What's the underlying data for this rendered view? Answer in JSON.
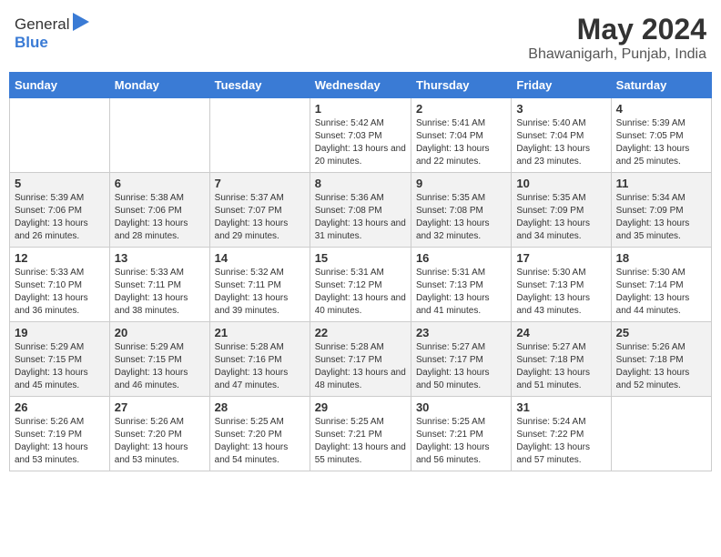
{
  "header": {
    "logo_general": "General",
    "logo_blue": "Blue",
    "title": "May 2024",
    "subtitle": "Bhawanigarh, Punjab, India"
  },
  "weekdays": [
    "Sunday",
    "Monday",
    "Tuesday",
    "Wednesday",
    "Thursday",
    "Friday",
    "Saturday"
  ],
  "weeks": [
    [
      {
        "day": "",
        "sunrise": "",
        "sunset": "",
        "daylight": ""
      },
      {
        "day": "",
        "sunrise": "",
        "sunset": "",
        "daylight": ""
      },
      {
        "day": "",
        "sunrise": "",
        "sunset": "",
        "daylight": ""
      },
      {
        "day": "1",
        "sunrise": "Sunrise: 5:42 AM",
        "sunset": "Sunset: 7:03 PM",
        "daylight": "Daylight: 13 hours and 20 minutes."
      },
      {
        "day": "2",
        "sunrise": "Sunrise: 5:41 AM",
        "sunset": "Sunset: 7:04 PM",
        "daylight": "Daylight: 13 hours and 22 minutes."
      },
      {
        "day": "3",
        "sunrise": "Sunrise: 5:40 AM",
        "sunset": "Sunset: 7:04 PM",
        "daylight": "Daylight: 13 hours and 23 minutes."
      },
      {
        "day": "4",
        "sunrise": "Sunrise: 5:39 AM",
        "sunset": "Sunset: 7:05 PM",
        "daylight": "Daylight: 13 hours and 25 minutes."
      }
    ],
    [
      {
        "day": "5",
        "sunrise": "Sunrise: 5:39 AM",
        "sunset": "Sunset: 7:06 PM",
        "daylight": "Daylight: 13 hours and 26 minutes."
      },
      {
        "day": "6",
        "sunrise": "Sunrise: 5:38 AM",
        "sunset": "Sunset: 7:06 PM",
        "daylight": "Daylight: 13 hours and 28 minutes."
      },
      {
        "day": "7",
        "sunrise": "Sunrise: 5:37 AM",
        "sunset": "Sunset: 7:07 PM",
        "daylight": "Daylight: 13 hours and 29 minutes."
      },
      {
        "day": "8",
        "sunrise": "Sunrise: 5:36 AM",
        "sunset": "Sunset: 7:08 PM",
        "daylight": "Daylight: 13 hours and 31 minutes."
      },
      {
        "day": "9",
        "sunrise": "Sunrise: 5:35 AM",
        "sunset": "Sunset: 7:08 PM",
        "daylight": "Daylight: 13 hours and 32 minutes."
      },
      {
        "day": "10",
        "sunrise": "Sunrise: 5:35 AM",
        "sunset": "Sunset: 7:09 PM",
        "daylight": "Daylight: 13 hours and 34 minutes."
      },
      {
        "day": "11",
        "sunrise": "Sunrise: 5:34 AM",
        "sunset": "Sunset: 7:09 PM",
        "daylight": "Daylight: 13 hours and 35 minutes."
      }
    ],
    [
      {
        "day": "12",
        "sunrise": "Sunrise: 5:33 AM",
        "sunset": "Sunset: 7:10 PM",
        "daylight": "Daylight: 13 hours and 36 minutes."
      },
      {
        "day": "13",
        "sunrise": "Sunrise: 5:33 AM",
        "sunset": "Sunset: 7:11 PM",
        "daylight": "Daylight: 13 hours and 38 minutes."
      },
      {
        "day": "14",
        "sunrise": "Sunrise: 5:32 AM",
        "sunset": "Sunset: 7:11 PM",
        "daylight": "Daylight: 13 hours and 39 minutes."
      },
      {
        "day": "15",
        "sunrise": "Sunrise: 5:31 AM",
        "sunset": "Sunset: 7:12 PM",
        "daylight": "Daylight: 13 hours and 40 minutes."
      },
      {
        "day": "16",
        "sunrise": "Sunrise: 5:31 AM",
        "sunset": "Sunset: 7:13 PM",
        "daylight": "Daylight: 13 hours and 41 minutes."
      },
      {
        "day": "17",
        "sunrise": "Sunrise: 5:30 AM",
        "sunset": "Sunset: 7:13 PM",
        "daylight": "Daylight: 13 hours and 43 minutes."
      },
      {
        "day": "18",
        "sunrise": "Sunrise: 5:30 AM",
        "sunset": "Sunset: 7:14 PM",
        "daylight": "Daylight: 13 hours and 44 minutes."
      }
    ],
    [
      {
        "day": "19",
        "sunrise": "Sunrise: 5:29 AM",
        "sunset": "Sunset: 7:15 PM",
        "daylight": "Daylight: 13 hours and 45 minutes."
      },
      {
        "day": "20",
        "sunrise": "Sunrise: 5:29 AM",
        "sunset": "Sunset: 7:15 PM",
        "daylight": "Daylight: 13 hours and 46 minutes."
      },
      {
        "day": "21",
        "sunrise": "Sunrise: 5:28 AM",
        "sunset": "Sunset: 7:16 PM",
        "daylight": "Daylight: 13 hours and 47 minutes."
      },
      {
        "day": "22",
        "sunrise": "Sunrise: 5:28 AM",
        "sunset": "Sunset: 7:17 PM",
        "daylight": "Daylight: 13 hours and 48 minutes."
      },
      {
        "day": "23",
        "sunrise": "Sunrise: 5:27 AM",
        "sunset": "Sunset: 7:17 PM",
        "daylight": "Daylight: 13 hours and 50 minutes."
      },
      {
        "day": "24",
        "sunrise": "Sunrise: 5:27 AM",
        "sunset": "Sunset: 7:18 PM",
        "daylight": "Daylight: 13 hours and 51 minutes."
      },
      {
        "day": "25",
        "sunrise": "Sunrise: 5:26 AM",
        "sunset": "Sunset: 7:18 PM",
        "daylight": "Daylight: 13 hours and 52 minutes."
      }
    ],
    [
      {
        "day": "26",
        "sunrise": "Sunrise: 5:26 AM",
        "sunset": "Sunset: 7:19 PM",
        "daylight": "Daylight: 13 hours and 53 minutes."
      },
      {
        "day": "27",
        "sunrise": "Sunrise: 5:26 AM",
        "sunset": "Sunset: 7:20 PM",
        "daylight": "Daylight: 13 hours and 53 minutes."
      },
      {
        "day": "28",
        "sunrise": "Sunrise: 5:25 AM",
        "sunset": "Sunset: 7:20 PM",
        "daylight": "Daylight: 13 hours and 54 minutes."
      },
      {
        "day": "29",
        "sunrise": "Sunrise: 5:25 AM",
        "sunset": "Sunset: 7:21 PM",
        "daylight": "Daylight: 13 hours and 55 minutes."
      },
      {
        "day": "30",
        "sunrise": "Sunrise: 5:25 AM",
        "sunset": "Sunset: 7:21 PM",
        "daylight": "Daylight: 13 hours and 56 minutes."
      },
      {
        "day": "31",
        "sunrise": "Sunrise: 5:24 AM",
        "sunset": "Sunset: 7:22 PM",
        "daylight": "Daylight: 13 hours and 57 minutes."
      },
      {
        "day": "",
        "sunrise": "",
        "sunset": "",
        "daylight": ""
      }
    ]
  ]
}
